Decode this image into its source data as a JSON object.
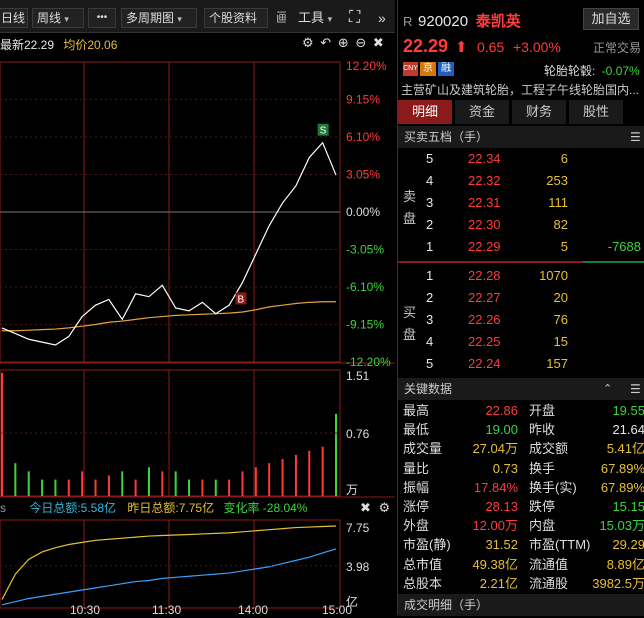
{
  "toolbar": {
    "day_label": "日线",
    "week_label": "周线",
    "more_label": "•••",
    "multi_period_label": "多周期图",
    "stock_info_label": "个股资料",
    "extra_label": "画",
    "tools_label": "工具",
    "expand_label": "⛶",
    "collapse_label": "»"
  },
  "chart_header": {
    "latest": "最新22.29",
    "avg": "均价20.06"
  },
  "price_axis": [
    "12.20%",
    "9.15%",
    "6.10%",
    "3.05%",
    "0.00%",
    "-3.05%",
    "-6.10%",
    "-9.15%",
    "-12.20%"
  ],
  "volume_axis": [
    "1.51",
    "0.76",
    "万"
  ],
  "sub_header": {
    "today_total": "今日总额:5.58亿",
    "yesterday_total": "昨日总额:7.75亿",
    "change_rate": "变化率 -28.04%"
  },
  "sub_axis": [
    "7.75",
    "3.98",
    "亿"
  ],
  "time_axis": [
    "10:30",
    "11:30",
    "14:00",
    "15:00"
  ],
  "markers": {
    "sell": "S",
    "buy": "B"
  },
  "colors": {
    "up": "#ff3b3b",
    "down": "#3cd43c",
    "avg_line": "#e6a23c",
    "price_line": "#ffffff",
    "sub_yellow": "#e6c030",
    "sub_blue": "#3aa0ff"
  },
  "chart_data": {
    "type": "line",
    "title": "",
    "xlabel": "",
    "ylabel": "",
    "ylim_pct": [
      -12.2,
      12.2
    ],
    "prev_close": 21.64,
    "x": [
      "09:30",
      "09:40",
      "09:50",
      "10:00",
      "10:10",
      "10:20",
      "10:30",
      "10:40",
      "10:50",
      "11:00",
      "11:10",
      "11:20",
      "11:30",
      "13:10",
      "13:20",
      "13:30",
      "13:40",
      "13:50",
      "14:00",
      "14:10",
      "14:20",
      "14:30",
      "14:40",
      "14:50",
      "14:55",
      "15:00"
    ],
    "series": [
      {
        "values": [
          19.6,
          19.5,
          19.4,
          19.35,
          19.3,
          19.45,
          19.8,
          20.0,
          20.1,
          19.75,
          20.2,
          20.15,
          20.35,
          19.95,
          19.9,
          20.05,
          19.85,
          20.0,
          20.4,
          20.9,
          21.4,
          21.8,
          22.1,
          22.6,
          22.86,
          22.29
        ]
      },
      {
        "values": [
          19.55,
          19.55,
          19.56,
          19.57,
          19.58,
          19.6,
          19.63,
          19.66,
          19.7,
          19.72,
          19.75,
          19.78,
          19.8,
          19.82,
          19.83,
          19.84,
          19.85,
          19.86,
          19.88,
          19.92,
          19.97,
          20.0,
          20.03,
          20.05,
          20.06,
          20.06
        ]
      }
    ],
    "volume": [
      1.5,
      0.4,
      0.3,
      0.2,
      0.2,
      0.2,
      0.3,
      0.2,
      0.25,
      0.3,
      0.2,
      0.35,
      0.3,
      0.3,
      0.2,
      0.2,
      0.2,
      0.2,
      0.3,
      0.35,
      0.4,
      0.45,
      0.5,
      0.55,
      0.6,
      1.0
    ],
    "volume_ylim": [
      0,
      1.51
    ],
    "sub_today": [
      0.3,
      0.6,
      0.9,
      1.1,
      1.3,
      1.5,
      1.7,
      1.9,
      2.1,
      2.3,
      2.5,
      2.6,
      2.8,
      2.9,
      3.0,
      3.1,
      3.2,
      3.3,
      3.5,
      3.7,
      3.9,
      4.2,
      4.5,
      4.8,
      5.2,
      5.58
    ],
    "sub_yesterday": [
      0.8,
      3.2,
      4.6,
      5.3,
      5.7,
      6.0,
      6.2,
      6.4,
      6.5,
      6.6,
      6.7,
      6.8,
      6.85,
      6.9,
      6.95,
      7.0,
      7.05,
      7.1,
      7.2,
      7.3,
      7.4,
      7.5,
      7.6,
      7.65,
      7.7,
      7.75
    ],
    "sub_ylim": [
      0,
      7.75
    ]
  },
  "quote": {
    "code_prefix": "R",
    "code": "920020",
    "name": "泰凯英",
    "add_watch": "加自选",
    "price": "22.29",
    "arrow": "⬆",
    "change": "0.65",
    "change_pct": "+3.00%",
    "status": "正常交易",
    "badges": [
      "CNY",
      "京",
      "融"
    ],
    "sector": "轮胎轮毂:",
    "sector_pct": "-0.07%",
    "description": "主营矿山及建筑轮胎，工程子午线轮胎国内..."
  },
  "tabs": [
    "明细",
    "资金",
    "财务",
    "股性"
  ],
  "order_book": {
    "title": "买卖五档（手）",
    "sell_label": "卖盘",
    "buy_label": "买盘",
    "sells": [
      {
        "level": "5",
        "price": "22.34",
        "vol": "6",
        "extra": ""
      },
      {
        "level": "4",
        "price": "22.32",
        "vol": "253",
        "extra": ""
      },
      {
        "level": "3",
        "price": "22.31",
        "vol": "111",
        "extra": ""
      },
      {
        "level": "2",
        "price": "22.30",
        "vol": "82",
        "extra": ""
      },
      {
        "level": "1",
        "price": "22.29",
        "vol": "5",
        "extra": "-7688"
      }
    ],
    "buys": [
      {
        "level": "1",
        "price": "22.28",
        "vol": "1070"
      },
      {
        "level": "2",
        "price": "22.27",
        "vol": "20"
      },
      {
        "level": "3",
        "price": "22.26",
        "vol": "76"
      },
      {
        "level": "4",
        "price": "22.25",
        "vol": "15"
      },
      {
        "level": "5",
        "price": "22.24",
        "vol": "157"
      }
    ]
  },
  "key_data": {
    "title": "关键数据",
    "rows": [
      {
        "l1": "最高",
        "v1": "22.86",
        "c1": "red",
        "l2": "开盘",
        "v2": "19.55",
        "c2": "green"
      },
      {
        "l1": "最低",
        "v1": "19.00",
        "c1": "green",
        "l2": "昨收",
        "v2": "21.64",
        "c2": "white"
      },
      {
        "l1": "成交量",
        "v1": "27.04万",
        "c1": "yellow",
        "l2": "成交额",
        "v2": "5.41亿",
        "c2": "yellow"
      },
      {
        "l1": "量比",
        "v1": "0.73",
        "c1": "yellow",
        "l2": "换手",
        "v2": "67.89%",
        "c2": "yellow"
      },
      {
        "l1": "振幅",
        "v1": "17.84%",
        "c1": "red",
        "l2": "换手(实)",
        "v2": "67.89%",
        "c2": "yellow"
      },
      {
        "l1": "涨停",
        "v1": "28.13",
        "c1": "red",
        "l2": "跌停",
        "v2": "15.15",
        "c2": "green"
      },
      {
        "l1": "外盘",
        "v1": "12.00万",
        "c1": "red",
        "l2": "内盘",
        "v2": "15.03万",
        "c2": "green"
      },
      {
        "l1": "市盈(静)",
        "v1": "31.52",
        "c1": "yellow",
        "l2": "市盈(TTM)",
        "v2": "29.29",
        "c2": "yellow"
      },
      {
        "l1": "总市值",
        "v1": "49.38亿",
        "c1": "yellow",
        "l2": "流通值",
        "v2": "8.89亿",
        "c2": "yellow"
      },
      {
        "l1": "总股本",
        "v1": "2.21亿",
        "c1": "yellow",
        "l2": "流通股",
        "v2": "3982.5万",
        "c2": "yellow"
      }
    ]
  },
  "trade_detail": {
    "title": "成交明细（手）"
  }
}
